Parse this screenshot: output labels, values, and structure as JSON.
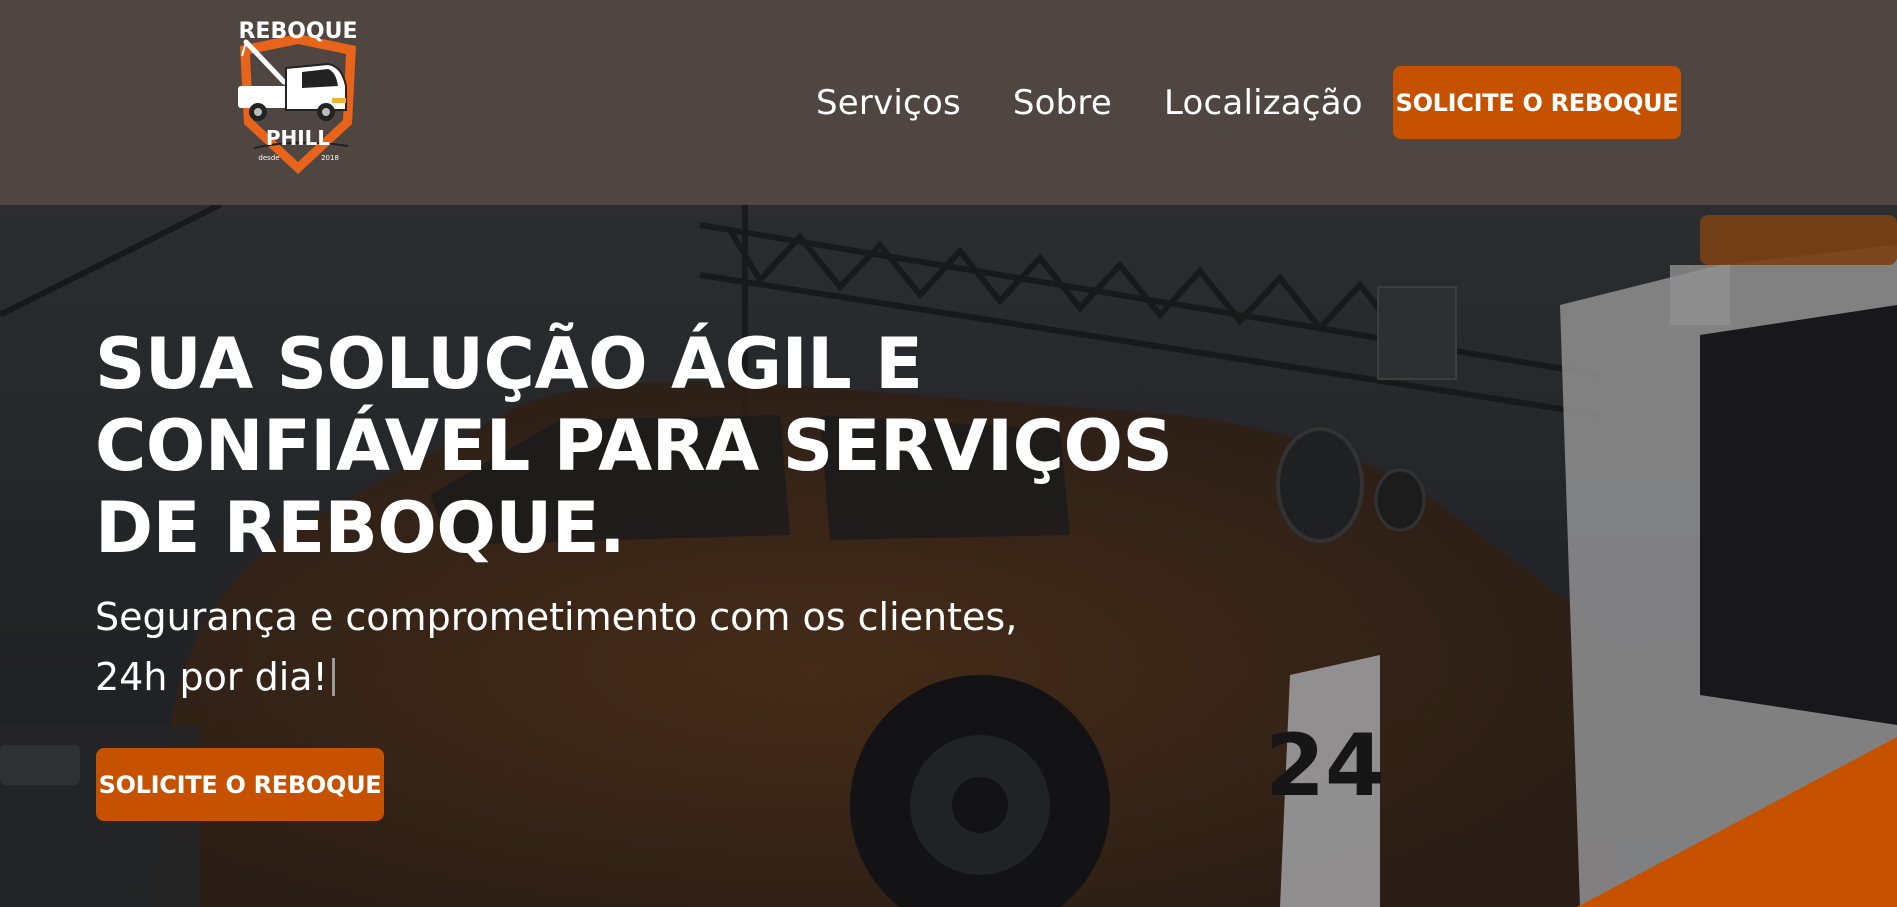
{
  "colors": {
    "header_bg": "#4f4641",
    "accent": "#c65200",
    "text": "#ffffff",
    "hero_overlay": "#25272a"
  },
  "logo": {
    "top_text": "REBOQUE",
    "bottom_text": "PHILL",
    "since_label": "desde",
    "since_year": "2018",
    "icon": "tow-truck-icon"
  },
  "nav": {
    "links": [
      "Serviços",
      "Sobre",
      "Localização"
    ],
    "cta_label": "SOLICITE O REBOQUE"
  },
  "hero": {
    "title_lines": [
      "SUA SOLUÇÃO ÁGIL E",
      "CONFIÁVEL PARA SERVIÇOS",
      "DE REBOQUE."
    ],
    "subtitle_lines": [
      "Segurança e comprometimento com os clientes,",
      "24h por dia!"
    ],
    "cta_label": "SOLICITE O REBOQUE",
    "background_sign_text": "24"
  }
}
